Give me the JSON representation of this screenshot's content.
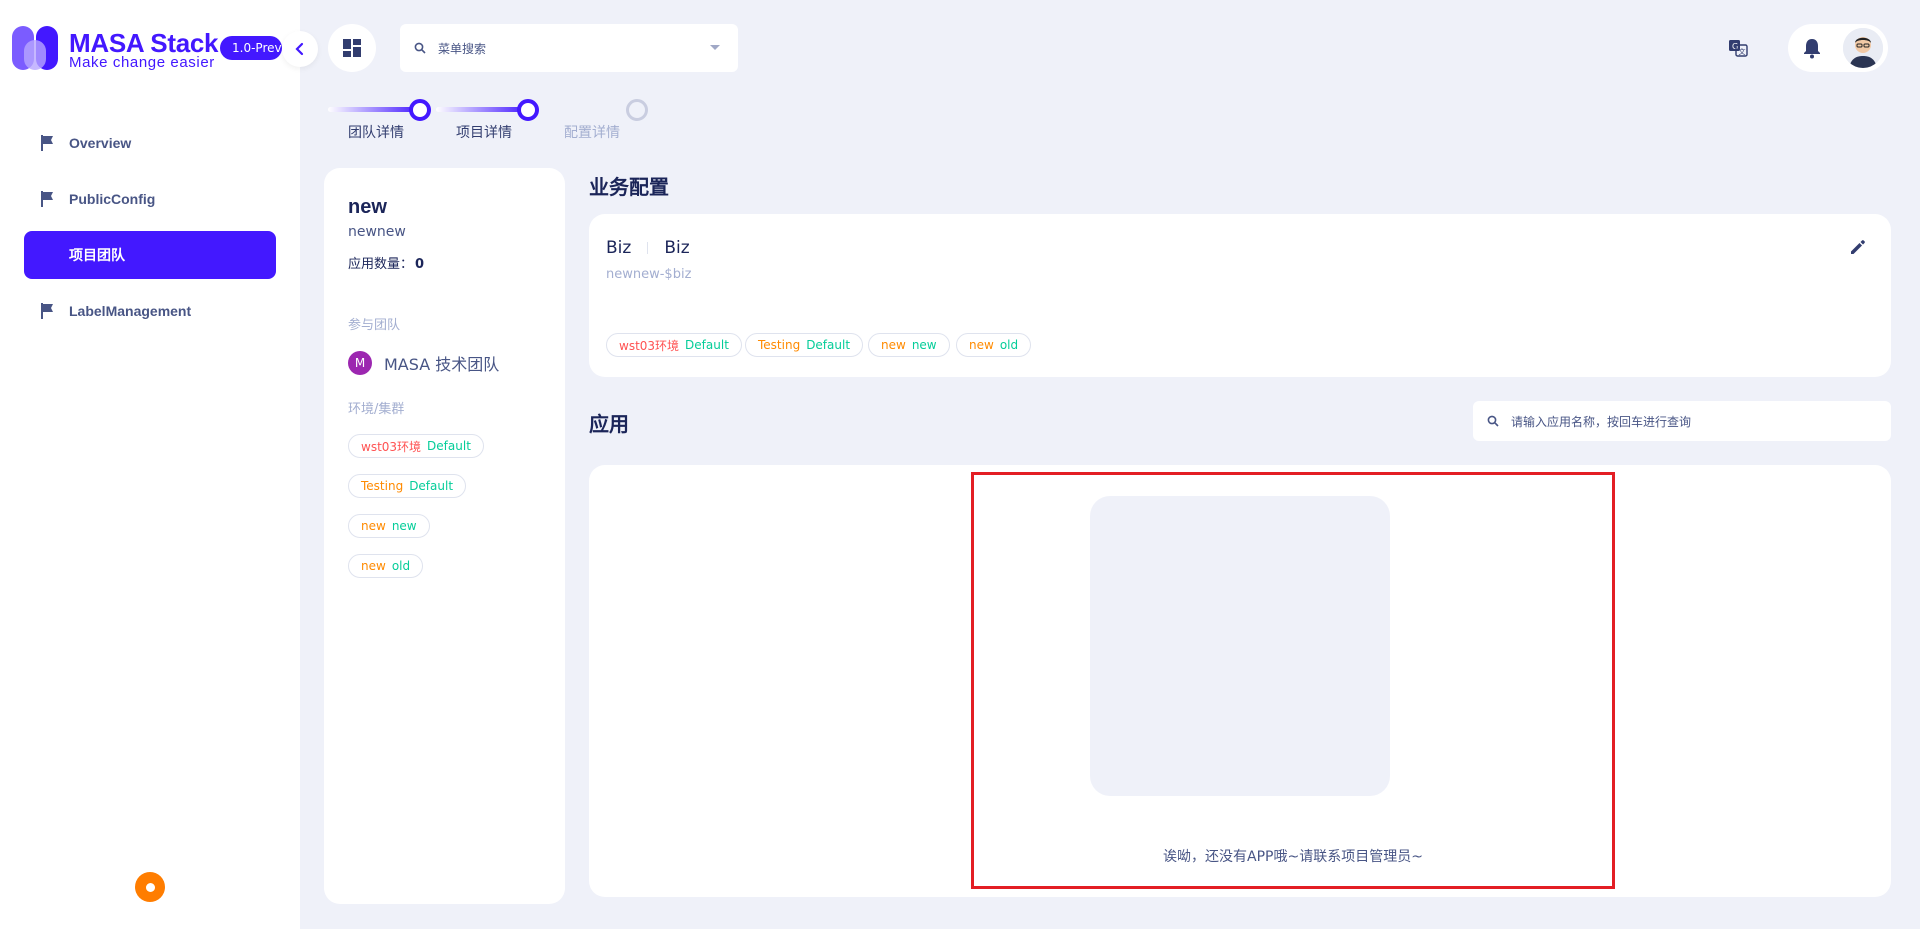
{
  "brand": {
    "name": "MASA Stack",
    "slogan": "Make change easier",
    "version": "1.0-Preview"
  },
  "sidebar": {
    "items": [
      {
        "label": "Overview",
        "icon": "flag-icon"
      },
      {
        "label": "PublicConfig",
        "icon": "flag-icon"
      },
      {
        "label": "项目团队",
        "icon": "flag-icon",
        "active": true
      },
      {
        "label": "LabelManagement",
        "icon": "flag-icon"
      }
    ]
  },
  "header": {
    "menu_search_placeholder": "菜单搜索"
  },
  "stepper": {
    "steps": [
      {
        "label": "团队详情",
        "state": "done"
      },
      {
        "label": "项目详情",
        "state": "done"
      },
      {
        "label": "配置详情",
        "state": "pending"
      }
    ]
  },
  "project": {
    "name": "new",
    "identity": "newnew",
    "app_count_label": "应用数量：",
    "app_count": "0",
    "team_section_label": "参与团队",
    "team_initial": "M",
    "team_name": "MASA 技术团队",
    "env_section_label": "环境/集群",
    "envs": [
      {
        "env": "wst03环境",
        "cluster": "Default"
      },
      {
        "env": "Testing",
        "cluster": "Default"
      },
      {
        "env": "new",
        "cluster": "new"
      },
      {
        "env": "new",
        "cluster": "old"
      }
    ]
  },
  "biz": {
    "section_title": "业务配置",
    "name": "Biz",
    "identity": "Biz",
    "app_id": "newnew-$biz",
    "envs": [
      {
        "env": "wst03环境",
        "cluster": "Default"
      },
      {
        "env": "Testing",
        "cluster": "Default"
      },
      {
        "env": "new",
        "cluster": "new"
      },
      {
        "env": "new",
        "cluster": "old"
      }
    ]
  },
  "apps": {
    "section_title": "应用",
    "search_placeholder": "请输入应用名称，按回车进行查询",
    "empty_text": "诶呦，还没有APP哦~请联系项目管理员~"
  },
  "colors": {
    "primary": "#4318ff",
    "background": "#eff1f9",
    "highlight": "#e31e24",
    "env_red": "#ff5252",
    "env_orange": "#ff8a00",
    "cluster_green": "#05cd99",
    "help": "#ff7d00"
  }
}
